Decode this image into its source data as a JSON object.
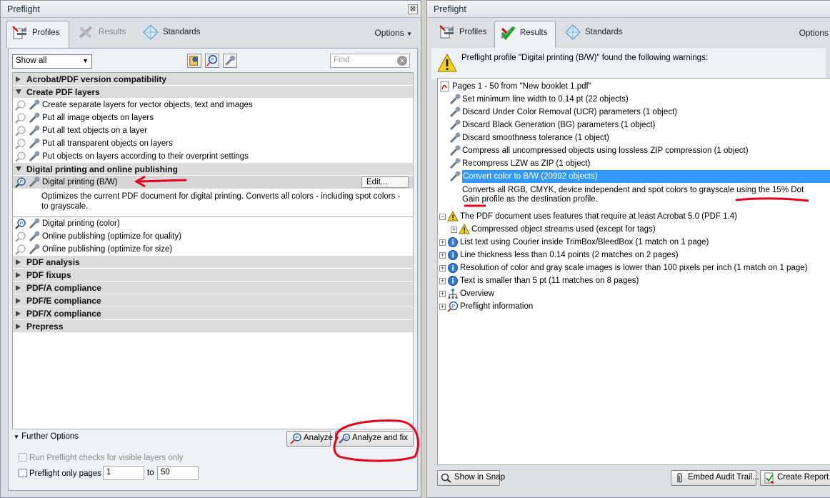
{
  "left": {
    "title": "Preflight",
    "close_glyph": "⊠",
    "tabs": {
      "profiles": "Profiles",
      "results": "Results",
      "standards": "Standards"
    },
    "options": "Options",
    "filter": "Show all",
    "find_placeholder": "Find",
    "groups": {
      "g1": "Acrobat/PDF version compatibility",
      "g2": "Create PDF layers",
      "g3": "Digital printing and online publishing",
      "g4": "PDF analysis",
      "g5": "PDF fixups",
      "g6": "PDF/A compliance",
      "g7": "PDF/E compliance",
      "g8": "PDF/X compliance",
      "g9": "Prepress"
    },
    "layers_items": [
      "Create separate layers for vector objects, text and images",
      "Put all image objects on layers",
      "Put all text objects on a layer",
      "Put all transparent objects on layers",
      "Put objects on layers according to their overprint settings"
    ],
    "digital_items": {
      "selected": "Digital printing (B/W)",
      "edit": "Edit...",
      "description": "Optimizes the current PDF document for digital printing. Converts all colors - including spot colors - to grayscale.",
      "color": "Digital printing (color)",
      "quality": "Online publishing (optimize for quality)",
      "size": "Online publishing (optimize for size)"
    },
    "further_options": "Further Options",
    "analyze": "Analyze",
    "analyze_fix": "Analyze and fix",
    "visible_layers": "Run Preflight checks for visible layers only",
    "only_pages": "Preflight only pages",
    "from_page": "1",
    "to_label": "to",
    "to_page": "50"
  },
  "right": {
    "title": "Preflight",
    "tabs": {
      "profiles": "Profiles",
      "results": "Results",
      "standards": "Standards"
    },
    "options": "Options",
    "warning_msg": "Preflight profile \"Digital printing (B/W)\" found the following warnings:",
    "root": "Pages 1 - 50 from \"New booklet 1.pdf\"",
    "fixups": [
      "Set minimum line width to 0.14 pt (22 objects)",
      "Discard Under Color Removal (UCR) parameters (1 object)",
      "Discard Black Generation (BG) parameters (1 object)",
      "Discard smoothness tolerance (1 object)",
      "Compress all uncompressed objects using lossless ZIP compression (1 object)",
      "Recompress LZW as ZIP (1 object)"
    ],
    "selected_fixup": "Convert color to B/W (20992 objects)",
    "fixup_desc": "Converts all RGB, CMYK, device independent and spot colors to grayscale using the 15% Dot Gain profile as the destination profile.",
    "pdf14": "The PDF document uses features that require at least Acrobat 5.0 (PDF 1.4)",
    "compressed": "Compressed object streams used (except for tags)",
    "infos": [
      "List text using Courier inside TrimBox/BleedBox (1 match on 1 page)",
      "Line thickness less than 0.14 points (2 matches on 2 pages)",
      "Resolution of color and gray scale images is lower than 100 pixels per inch (1 match on 1 page)",
      "Text is smaller than 5 pt (11 matches on 8 pages)"
    ],
    "overview": "Overview",
    "preflight_info": "Preflight information",
    "show_snap": "Show in Snap",
    "embed_audit": "Embed Audit Trail...",
    "create_report": "Create Report..."
  },
  "colors": {
    "highlight": "#3399ff",
    "annotation": "#e8001c"
  }
}
